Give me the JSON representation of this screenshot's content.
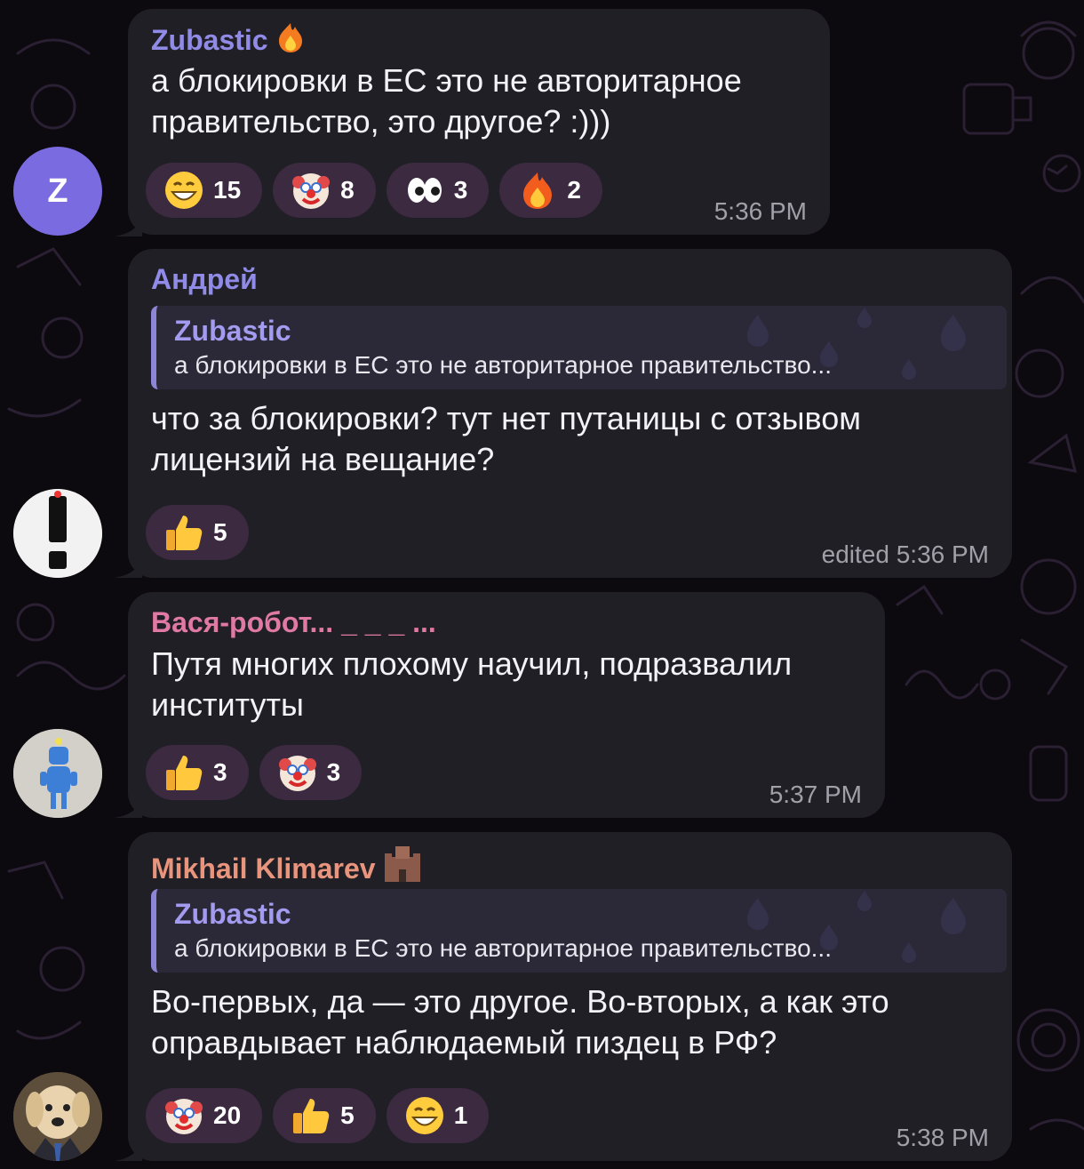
{
  "colors": {
    "background": "#0c0a0e",
    "bubble": "#211f26",
    "reply_bar": "#8d86d8",
    "reaction_chip": "#3b2a40",
    "time_text": "#a19fa8"
  },
  "messages": [
    {
      "sender": "Zubastic",
      "sender_color": "#8f8be6",
      "sender_badge": "fire-icon",
      "avatar": {
        "type": "letter",
        "letter": "Z",
        "color": "#7b6be0"
      },
      "text": "а блокировки в ЕС это не авторитарное правительство, это другое? :)))",
      "reactions": [
        {
          "icon": "grin-emoji-icon",
          "count": "15"
        },
        {
          "icon": "clown-emoji-icon",
          "count": "8"
        },
        {
          "icon": "eyes-emoji-icon",
          "count": "3"
        },
        {
          "icon": "fire-emoji-icon",
          "count": "2"
        }
      ],
      "time": "5:36 PM"
    },
    {
      "sender": "Андрей",
      "sender_color": "#8f8be6",
      "avatar": {
        "type": "image",
        "icon": "exclamation-avatar-icon"
      },
      "reply": {
        "name": "Zubastic",
        "text": "а блокировки в ЕС это не авторитарное правительство..."
      },
      "text": "что за блокировки? тут нет путаницы с отзывом лицензий на вещание?",
      "reactions": [
        {
          "icon": "thumbs-up-emoji-icon",
          "count": "5"
        }
      ],
      "time": "edited 5:36 PM"
    },
    {
      "sender": "Вася-робот... _ _ _ ...",
      "sender_color": "#e07aa4",
      "avatar": {
        "type": "image",
        "icon": "robot-avatar-icon"
      },
      "text": "Путя многих плохому научил, подразвалил институты",
      "reactions": [
        {
          "icon": "thumbs-up-emoji-icon",
          "count": "3"
        },
        {
          "icon": "clown-emoji-icon",
          "count": "3"
        }
      ],
      "time": "5:37 PM"
    },
    {
      "sender": "Mikhail Klimarev",
      "sender_color": "#e9957e",
      "sender_badge": "castle-icon",
      "avatar": {
        "type": "image",
        "icon": "dog-in-suit-avatar-icon"
      },
      "reply": {
        "name": "Zubastic",
        "text": "а блокировки в ЕС это не авторитарное правительство..."
      },
      "text": "Во-первых, да — это другое. Во-вторых, а как это оправдывает наблюдаемый пиздец в РФ?",
      "reactions": [
        {
          "icon": "clown-emoji-icon",
          "count": "20"
        },
        {
          "icon": "thumbs-up-emoji-icon",
          "count": "5"
        },
        {
          "icon": "grin-emoji-icon",
          "count": "1"
        }
      ],
      "time": "5:38 PM"
    }
  ]
}
